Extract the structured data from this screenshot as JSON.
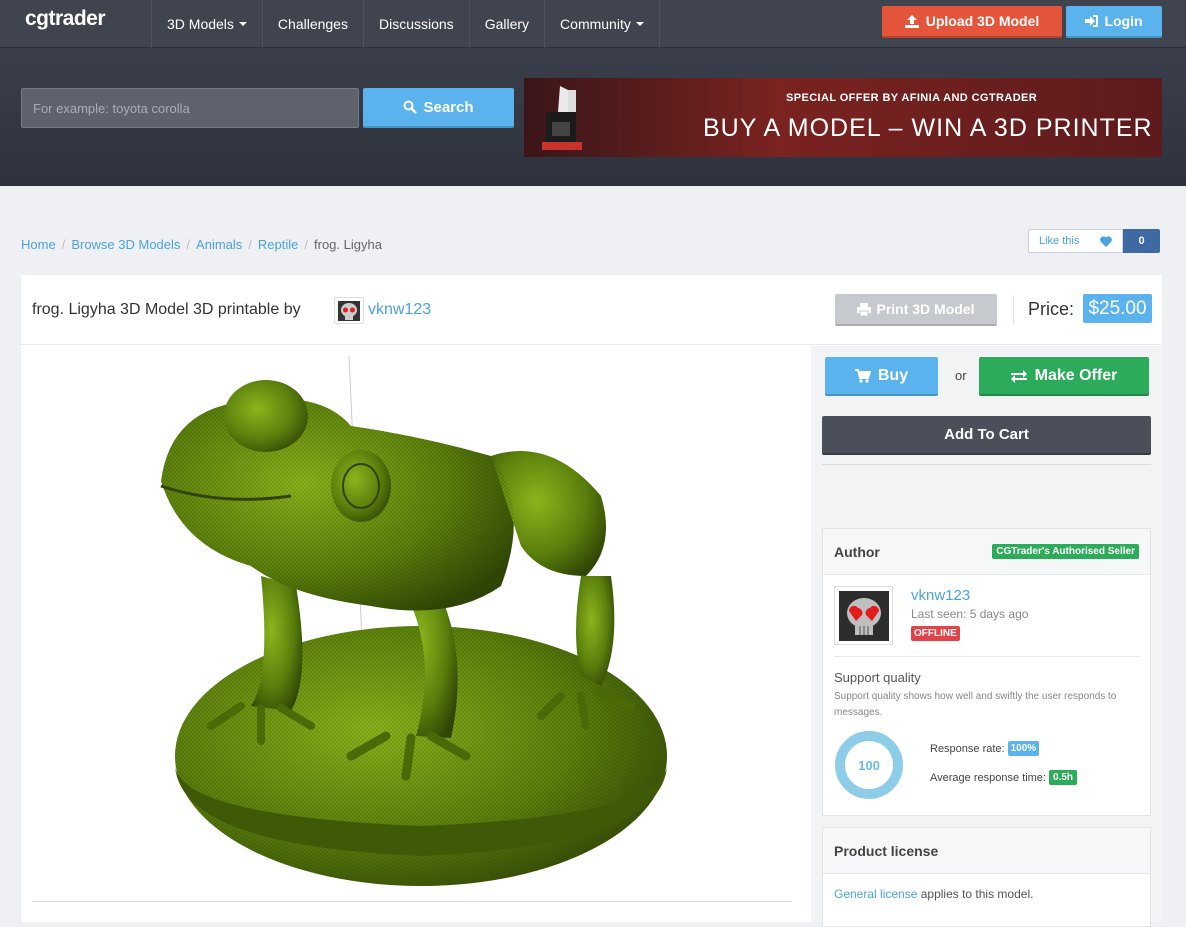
{
  "nav": {
    "logo": "cgtrader",
    "items": [
      {
        "label": "3D Models",
        "dropdown": true
      },
      {
        "label": "Challenges",
        "dropdown": false
      },
      {
        "label": "Discussions",
        "dropdown": false
      },
      {
        "label": "Gallery",
        "dropdown": false
      },
      {
        "label": "Community",
        "dropdown": true
      }
    ],
    "upload_label": "Upload 3D Model",
    "login_label": "Login"
  },
  "search": {
    "placeholder": "For example: toyota corolla",
    "button_label": "Search"
  },
  "banner": {
    "offer": "SPECIAL OFFER BY AFINIA AND CGTRADER",
    "headline": "BUY A MODEL – WIN A 3D PRINTER"
  },
  "breadcrumb": [
    "Home",
    "Browse 3D Models",
    "Animals",
    "Reptile",
    "frog. Ligyha"
  ],
  "like": {
    "label": "Like this",
    "count": "0"
  },
  "product": {
    "title": "frog. Ligyha 3D Model 3D printable by",
    "author": "vknw123",
    "print_label": "Print 3D Model",
    "price_label": "Price:",
    "price": "$25.00"
  },
  "actions": {
    "buy_label": "Buy",
    "or_label": "or",
    "offer_label": "Make Offer",
    "cart_label": "Add To Cart"
  },
  "author_box": {
    "title": "Author",
    "badge": "CGTrader's Authorised Seller",
    "name": "vknw123",
    "last_seen": "Last seen: 5 days ago",
    "status": "OFFLINE",
    "support_title": "Support quality",
    "support_desc": "Support quality shows how well and swiftly the user responds to messages.",
    "score": "100",
    "response_rate_label": "Response rate:",
    "response_rate": "100%",
    "response_time_label": "Average response time:",
    "response_time": "0.5h"
  },
  "license": {
    "title": "Product license",
    "link": "General license",
    "text": " applies to this model."
  },
  "colors": {
    "accent": "#5ab3ec",
    "upload": "#e4553b",
    "offer": "#2cab5a",
    "nav": "#40444f",
    "offline": "#e2434a"
  }
}
